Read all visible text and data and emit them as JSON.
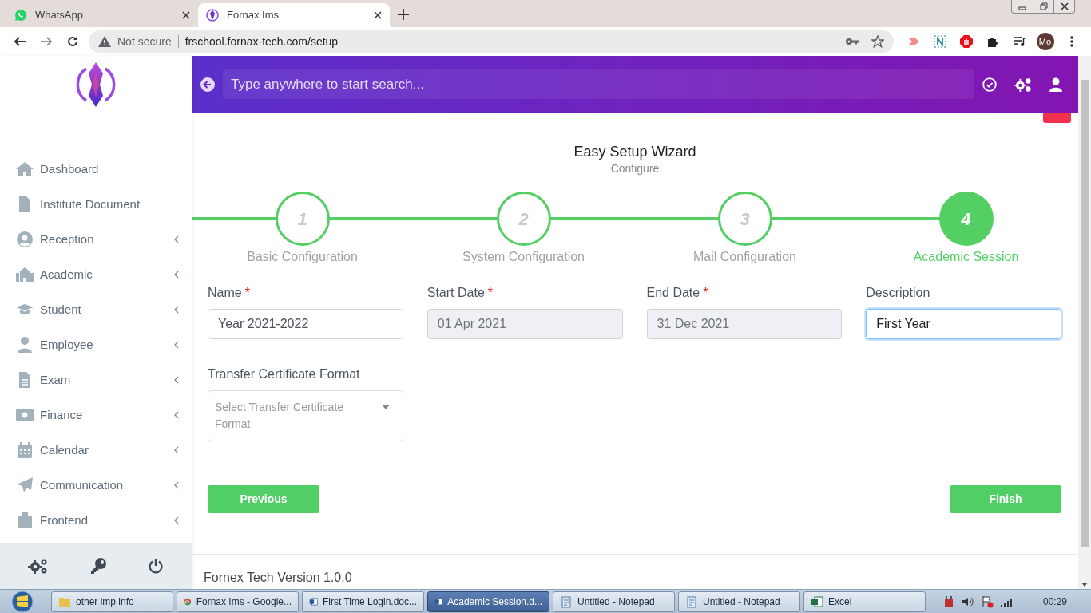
{
  "browser": {
    "tabs": [
      {
        "title": "WhatsApp",
        "kind": "whatsapp",
        "selected": false
      },
      {
        "title": "Fornax Ims",
        "kind": "app",
        "selected": true
      }
    ],
    "address": {
      "security": "Not secure",
      "url": "frschool.fornax-tech.com/setup"
    },
    "profile": "Mo"
  },
  "sidebar": {
    "items": [
      {
        "label": "Dashboard",
        "has_submenu": false
      },
      {
        "label": "Institute Document",
        "has_submenu": false
      },
      {
        "label": "Reception",
        "has_submenu": true
      },
      {
        "label": "Academic",
        "has_submenu": true
      },
      {
        "label": "Student",
        "has_submenu": true
      },
      {
        "label": "Employee",
        "has_submenu": true
      },
      {
        "label": "Exam",
        "has_submenu": true
      },
      {
        "label": "Finance",
        "has_submenu": true
      },
      {
        "label": "Calendar",
        "has_submenu": true
      },
      {
        "label": "Communication",
        "has_submenu": true
      },
      {
        "label": "Frontend",
        "has_submenu": true
      }
    ]
  },
  "header": {
    "search": {
      "placeholder": "Type anywhere to start search..."
    }
  },
  "wizard": {
    "title": "Easy Setup Wizard",
    "subtitle": "Configure",
    "steps": [
      {
        "number": "1",
        "label": "Basic Configuration",
        "selected": false
      },
      {
        "number": "2",
        "label": "System Configuration",
        "selected": false
      },
      {
        "number": "3",
        "label": "Mail Configuration",
        "selected": false
      },
      {
        "number": "4",
        "label": "Academic Session",
        "selected": true
      }
    ]
  },
  "form": {
    "fields": [
      {
        "label": "Name",
        "required_mark": "*",
        "value": "Year 2021-2022",
        "disabled": false,
        "focused": false
      },
      {
        "label": "Start Date",
        "required_mark": "*",
        "value": "01 Apr 2021",
        "disabled": true,
        "focused": false
      },
      {
        "label": "End Date",
        "required_mark": "*",
        "value": "31 Dec 2021",
        "disabled": true,
        "focused": false
      },
      {
        "label": "Description",
        "value": "First Year",
        "disabled": false,
        "focused": true
      }
    ],
    "select": {
      "label": "Transfer Certificate Format",
      "placeholder": "Select Transfer Certificate Format"
    },
    "buttons": {
      "previous": "Previous",
      "finish": "Finish"
    }
  },
  "footer": "Fornex Tech Version 1.0.0",
  "taskbar": {
    "items": [
      {
        "label": "other imp info",
        "kind": "folder",
        "selected": false
      },
      {
        "label": "Fornax Ims - Google...",
        "kind": "browser",
        "selected": false
      },
      {
        "label": "First Time Login.doc...",
        "kind": "word",
        "selected": false
      },
      {
        "label": "Academic Session.d...",
        "kind": "word",
        "selected": true
      },
      {
        "label": "Untitled - Notepad",
        "kind": "notepad",
        "selected": false
      },
      {
        "label": "Untitled - Notepad",
        "kind": "notepad",
        "selected": false
      },
      {
        "label": "Excel",
        "kind": "excel",
        "selected": false
      }
    ],
    "clock": "00:29"
  }
}
